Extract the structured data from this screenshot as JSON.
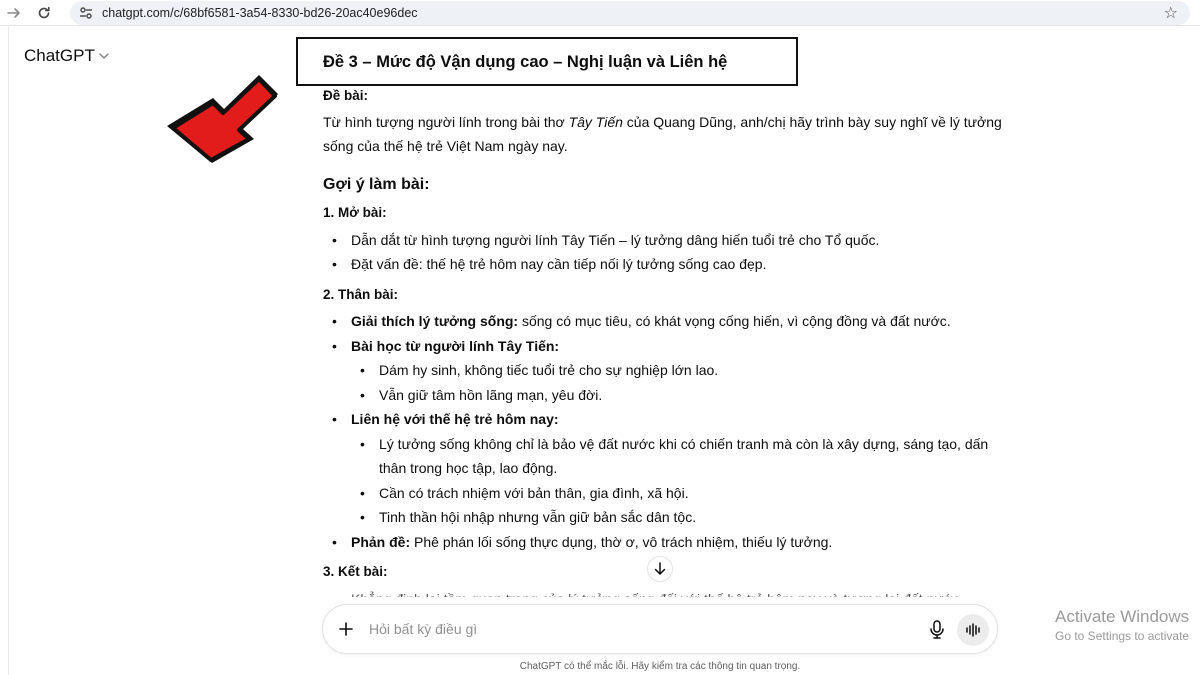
{
  "browser": {
    "url": "chatgpt.com/c/68bf6581-3a54-8330-bd26-20ac40e96dec",
    "back_icon": "arrow-right-icon",
    "reload_icon": "reload-icon",
    "bookmark_icon": "star-icon"
  },
  "app": {
    "title": "ChatGPT",
    "title_chevron": "⌵"
  },
  "annotation": {
    "arrow_color": "#e21b1b"
  },
  "message": {
    "heading": "Đề 3 – Mức độ Vận dụng cao – Nghị luận và Liên hệ",
    "prompt_label": "Đề bài:",
    "prompt_before": "Từ hình tượng người lính trong bài thơ ",
    "prompt_italic": "Tây Tiến",
    "prompt_after": " của Quang Dũng, anh/chị hãy trình bày suy nghĩ về lý tưởng sống của thế hệ trẻ Việt Nam ngày nay.",
    "guide_title": "Gợi ý làm bài:",
    "section1": {
      "title": "1. Mở bài:",
      "items": [
        "Dẫn dắt từ hình tượng người lính Tây Tiến – lý tưởng dâng hiến tuổi trẻ cho Tổ quốc.",
        "Đặt vấn đề: thế hệ trẻ hôm nay cần tiếp nối lý tưởng sống cao đẹp."
      ]
    },
    "section2": {
      "title": "2. Thân bài:",
      "explain_bold": "Giải thích lý tưởng sống:",
      "explain_text": " sống có mục tiêu, có khát vọng cống hiến, vì cộng đồng và đất nước.",
      "lesson_bold": "Bài học từ người lính Tây Tiến:",
      "lesson_items": [
        "Dám hy sinh, không tiếc tuổi trẻ cho sự nghiệp lớn lao.",
        "Vẫn giữ tâm hồn lãng mạn, yêu đời."
      ],
      "relate_bold": "Liên hệ với thế hệ trẻ hôm nay:",
      "relate_items": [
        "Lý tưởng sống không chỉ là bảo vệ đất nước khi có chiến tranh mà còn là xây dựng, sáng tạo, dấn thân trong học tập, lao động.",
        "Cần có trách nhiệm với bản thân, gia đình, xã hội.",
        "Tinh thần hội nhập nhưng vẫn giữ bản sắc dân tộc."
      ],
      "counter_bold": "Phản đề:",
      "counter_text": " Phê phán lối sống thực dụng, thờ ơ, vô trách nhiệm, thiếu lý tưởng."
    },
    "section3": {
      "title": "3. Kết bài:",
      "partial_item": "Khẳng định lại tầm quan trọng của lý tưởng sống đối với thế hệ trẻ hôm nay và tương lai đất nước."
    }
  },
  "composer": {
    "placeholder": "Hỏi bất kỳ điều gì",
    "plus_icon": "plus-icon",
    "mic_icon": "microphone-icon",
    "voice_icon": "voice-mode-icon"
  },
  "disclaimer": "ChatGPT có thể mắc lỗi. Hãy kiểm tra các thông tin quan trọng.",
  "watermark": {
    "line1": "Activate Windows",
    "line2": "Go to Settings to activate"
  }
}
